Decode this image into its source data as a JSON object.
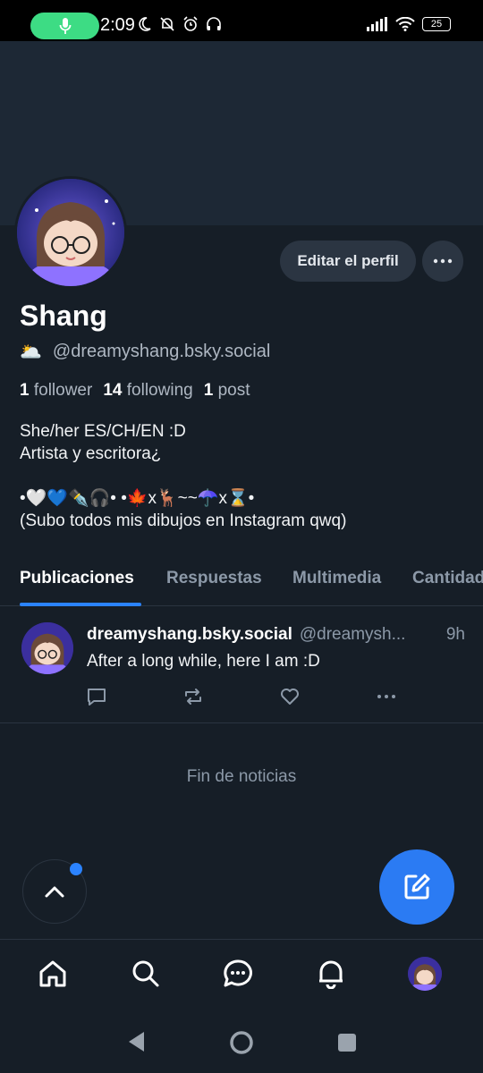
{
  "status_bar": {
    "time": "2:09",
    "battery": "25",
    "icons": [
      "mic-icon",
      "moon-icon",
      "bell-off-icon",
      "alarm-icon",
      "headphones-icon",
      "signal-icon",
      "wifi-icon",
      "battery-icon"
    ]
  },
  "profile": {
    "display_name": "Shang",
    "handle_emoji": "🌥️",
    "handle": "@dreamyshang.bsky.social",
    "followers_count": "1",
    "followers_label": "follower",
    "following_count": "14",
    "following_label": "following",
    "posts_count": "1",
    "posts_label": "post",
    "bio": "She/her ES/CH/EN :D\nArtista y escritora¿\n\n•🤍💙✒️🎧• •🍁x🦌~~☂️x⌛•\n(Subo todos mis dibujos en Instagram qwq)",
    "edit_button": "Editar el perfil",
    "more_button": "···"
  },
  "tabs": [
    {
      "label": "Publicaciones",
      "active": true
    },
    {
      "label": "Respuestas",
      "active": false
    },
    {
      "label": "Multimedia",
      "active": false
    },
    {
      "label": "Cantidad",
      "active": false
    }
  ],
  "post": {
    "author": "dreamyshang.bsky.social",
    "handle": "@dreamysh...",
    "time": "9h",
    "text": "After a long while, here I am :D"
  },
  "feed_end": "Fin de noticias",
  "colors": {
    "accent": "#2b83ff",
    "compose": "#2b7bf3",
    "background": "#161e27",
    "banner": "#1d2835",
    "mic_pill": "#3ddc84"
  }
}
